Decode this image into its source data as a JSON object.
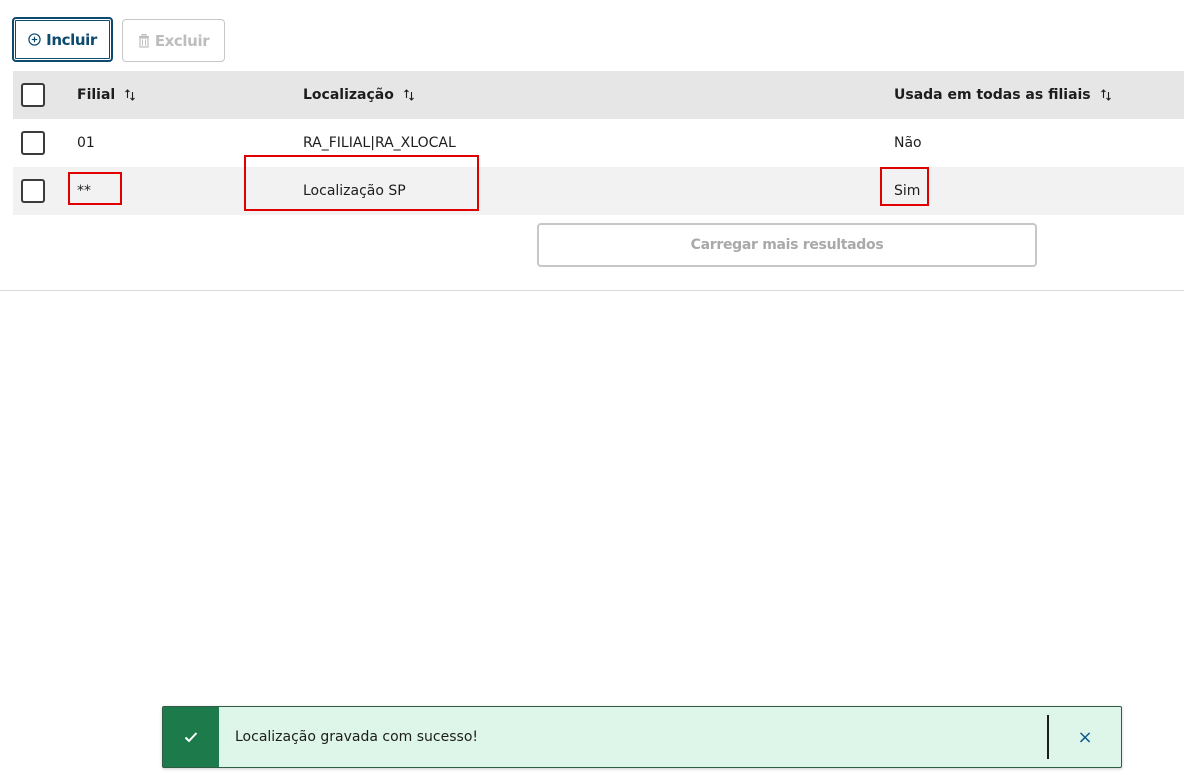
{
  "toolbar": {
    "include_label": "Incluir",
    "delete_label": "Excluir"
  },
  "table": {
    "columns": [
      "Filial",
      "Localização",
      "Usada em todas as filiais"
    ],
    "rows": [
      {
        "filial": "01",
        "localizacao": "RA_FILIAL|RA_XLOCAL",
        "usada": "Não"
      },
      {
        "filial": "**",
        "localizacao": "Localização SP",
        "usada": "Sim"
      }
    ]
  },
  "load_more_label": "Carregar mais resultados",
  "toast": {
    "message": "Localização gravada com sucesso!",
    "close_symbol": "×"
  },
  "colors": {
    "primary": "#0c4a6e",
    "highlight": "#e00000",
    "success": "#1d7a4a",
    "toast_bg": "#def5ea"
  }
}
